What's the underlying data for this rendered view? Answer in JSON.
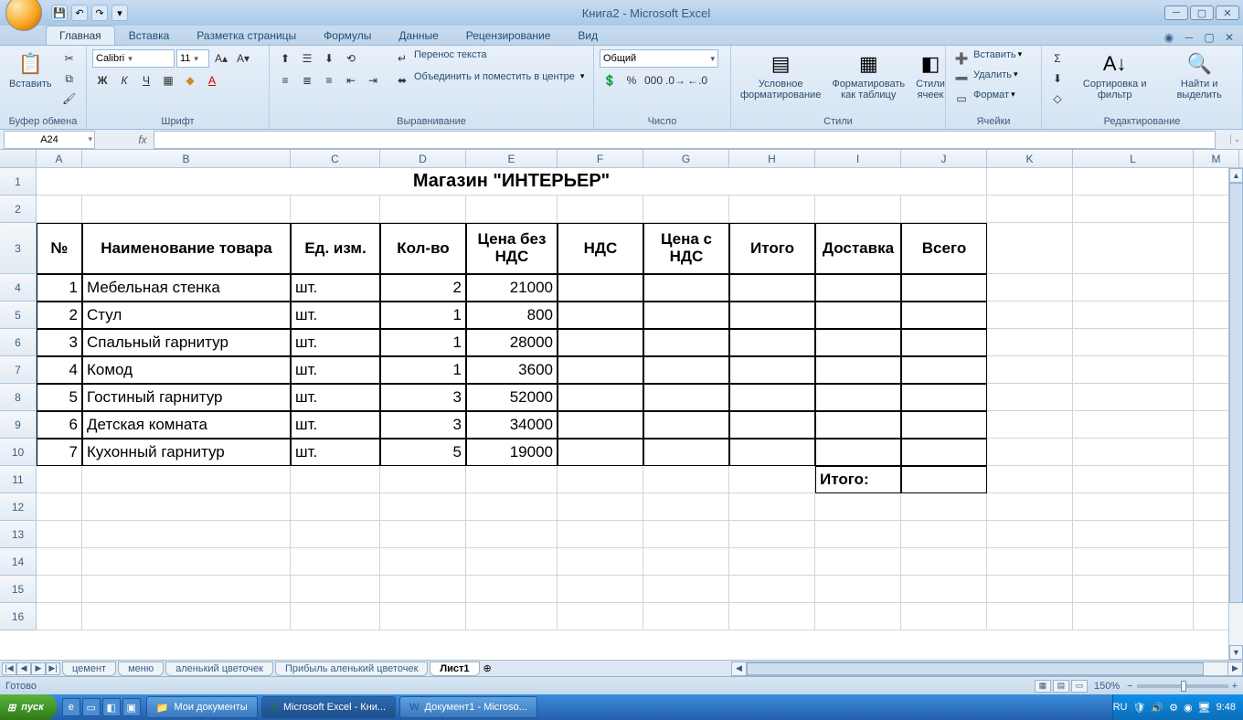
{
  "title": "Книга2 - Microsoft Excel",
  "tabs": {
    "home": "Главная",
    "insert": "Вставка",
    "layout": "Разметка страницы",
    "formulas": "Формулы",
    "data": "Данные",
    "review": "Рецензирование",
    "view": "Вид"
  },
  "groups": {
    "clipboard": "Буфер обмена",
    "font": "Шрифт",
    "alignment": "Выравнивание",
    "number": "Число",
    "styles": "Стили",
    "cells": "Ячейки",
    "editing": "Редактирование"
  },
  "clipboard": {
    "paste": "Вставить"
  },
  "font": {
    "name": "Calibri",
    "size": "11"
  },
  "alignment": {
    "wrap": "Перенос текста",
    "merge": "Объединить и поместить в центре"
  },
  "number": {
    "format": "Общий"
  },
  "styles": {
    "cond": "Условное форматирование",
    "table": "Форматировать как таблицу",
    "cell": "Стили ячеек"
  },
  "cells": {
    "insert": "Вставить",
    "delete": "Удалить",
    "format": "Формат"
  },
  "editing": {
    "sort": "Сортировка и фильтр",
    "find": "Найти и выделить"
  },
  "namebox": "A24",
  "cols": [
    "A",
    "B",
    "C",
    "D",
    "E",
    "F",
    "G",
    "H",
    "I",
    "J",
    "K",
    "L",
    "M"
  ],
  "sheet": {
    "title": "Магазин \"ИНТЕРЬЕР\"",
    "headers": {
      "no": "№",
      "name": "Наименование товара",
      "unit": "Ед. изм.",
      "qty": "Кол-во",
      "price": "Цена без НДС",
      "vat": "НДС",
      "priceVat": "Цена с НДС",
      "total": "Итого",
      "delivery": "Доставка",
      "grand": "Всего"
    },
    "rows": [
      {
        "no": "1",
        "name": "Мебельная стенка",
        "unit": "шт.",
        "qty": "2",
        "price": "21000"
      },
      {
        "no": "2",
        "name": "Стул",
        "unit": "шт.",
        "qty": "1",
        "price": "800"
      },
      {
        "no": "3",
        "name": "Спальный гарнитур",
        "unit": "шт.",
        "qty": "1",
        "price": "28000"
      },
      {
        "no": "4",
        "name": "Комод",
        "unit": "шт.",
        "qty": "1",
        "price": "3600"
      },
      {
        "no": "5",
        "name": "Гостиный гарнитур",
        "unit": "шт.",
        "qty": "3",
        "price": "52000"
      },
      {
        "no": "6",
        "name": "Детская комната",
        "unit": "шт.",
        "qty": "3",
        "price": "34000"
      },
      {
        "no": "7",
        "name": "Кухонный гарнитур",
        "unit": "шт.",
        "qty": "5",
        "price": "19000"
      }
    ],
    "totalLabel": "Итого:"
  },
  "sheetTabs": [
    "цемент",
    "меню",
    "аленький цветочек",
    "Прибыль аленький цветочек",
    "Лист1"
  ],
  "activeSheet": 4,
  "status": {
    "ready": "Готово",
    "zoom": "150%"
  },
  "taskbar": {
    "start": "пуск",
    "docs": "Мои документы",
    "excel": "Microsoft Excel - Кни...",
    "word": "Документ1 - Microso...",
    "lang": "RU",
    "time": "9:48"
  }
}
